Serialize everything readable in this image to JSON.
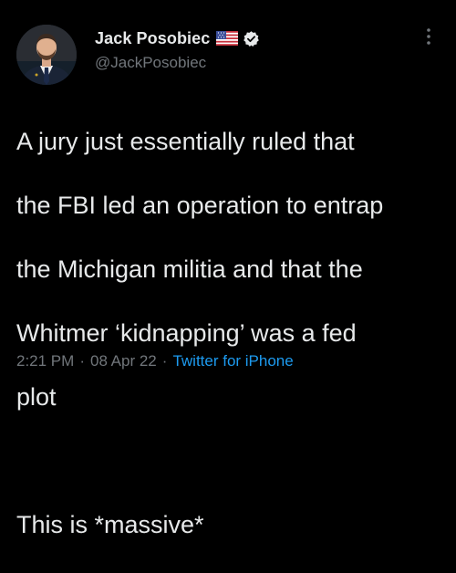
{
  "author": {
    "display_name": "Jack Posobiec",
    "handle": "@JackPosobiec",
    "flag_icon": "us-flag-icon",
    "verified_icon": "verified-badge-icon",
    "avatar": "profile-avatar"
  },
  "tweet": {
    "lines": [
      "A jury just essentially ruled that",
      "the FBI led an operation to entrap",
      "the Michigan militia and that the",
      "Whitmer ‘kidnapping’ was a fed",
      "plot"
    ],
    "last_line": "This is *massive*",
    "time": "2:21 PM",
    "separator": "·",
    "date": "08 Apr 22",
    "source": "Twitter for iPhone"
  },
  "menu": {
    "icon": "more-options-icon"
  },
  "colors": {
    "background": "#000000",
    "text": "#e7e9ea",
    "secondary": "#71767b",
    "accent": "#1d9bf0"
  }
}
